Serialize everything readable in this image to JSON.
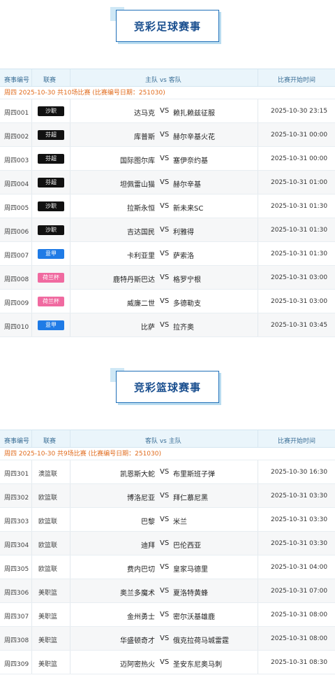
{
  "football": {
    "title": "竞彩足球赛事",
    "headers": {
      "id": "赛事编号",
      "league": "联赛",
      "teams": "主队 vs 客队",
      "time": "比赛开始时间"
    },
    "date_line": "周四 2025-10-30 共10场比赛 (比赛编号日期：251030)",
    "matches": [
      {
        "id": "周四001",
        "league": "沙职",
        "color": "#111111",
        "home": "达马克",
        "vs": "VS",
        "away": "赖扎赖兹征服",
        "time": "2025-10-30 23:15"
      },
      {
        "id": "周四002",
        "league": "芬超",
        "color": "#111111",
        "home": "库普斯",
        "vs": "VS",
        "away": "赫尔辛基火花",
        "time": "2025-10-31 00:00"
      },
      {
        "id": "周四003",
        "league": "芬超",
        "color": "#111111",
        "home": "国际图尔库",
        "vs": "VS",
        "away": "塞伊奈约基",
        "time": "2025-10-31 00:00"
      },
      {
        "id": "周四004",
        "league": "芬超",
        "color": "#111111",
        "home": "坦佩雷山猫",
        "vs": "VS",
        "away": "赫尔辛基",
        "time": "2025-10-31 01:00"
      },
      {
        "id": "周四005",
        "league": "沙职",
        "color": "#111111",
        "home": "拉斯永恒",
        "vs": "VS",
        "away": "新未来SC",
        "time": "2025-10-31 01:30"
      },
      {
        "id": "周四006",
        "league": "沙职",
        "color": "#111111",
        "home": "吉达国民",
        "vs": "VS",
        "away": "利雅得",
        "time": "2025-10-31 01:30"
      },
      {
        "id": "周四007",
        "league": "意甲",
        "color": "#1f7be6",
        "home": "卡利亚里",
        "vs": "VS",
        "away": "萨索洛",
        "time": "2025-10-31 01:30"
      },
      {
        "id": "周四008",
        "league": "荷兰杯",
        "color": "#f06aa0",
        "home": "鹿特丹斯巴达",
        "vs": "VS",
        "away": "格罗宁根",
        "time": "2025-10-31 03:00"
      },
      {
        "id": "周四009",
        "league": "荷兰杯",
        "color": "#f06aa0",
        "home": "威廉二世",
        "vs": "VS",
        "away": "多德勒支",
        "time": "2025-10-31 03:00"
      },
      {
        "id": "周四010",
        "league": "意甲",
        "color": "#1f7be6",
        "home": "比萨",
        "vs": "VS",
        "away": "拉齐奥",
        "time": "2025-10-31 03:45"
      }
    ]
  },
  "basketball": {
    "title": "竞彩篮球赛事",
    "headers": {
      "id": "赛事编号",
      "league": "联赛",
      "teams": "客队 vs 主队",
      "time": "比赛开始时间"
    },
    "date_line": "周四 2025-10-30 共9场比赛 (比赛编号日期：251030)",
    "matches": [
      {
        "id": "周四301",
        "league": "澳篮联",
        "away": "凯恩斯大蛇",
        "vs": "VS",
        "home": "布里斯班子弹",
        "time": "2025-10-30 16:30"
      },
      {
        "id": "周四302",
        "league": "欧篮联",
        "away": "博洛尼亚",
        "vs": "VS",
        "home": "拜仁慕尼黑",
        "time": "2025-10-31 03:30"
      },
      {
        "id": "周四303",
        "league": "欧篮联",
        "away": "巴黎",
        "vs": "VS",
        "home": "米兰",
        "time": "2025-10-31 03:30"
      },
      {
        "id": "周四304",
        "league": "欧篮联",
        "away": "迪拜",
        "vs": "VS",
        "home": "巴伦西亚",
        "time": "2025-10-31 03:30"
      },
      {
        "id": "周四305",
        "league": "欧篮联",
        "away": "费内巴切",
        "vs": "VS",
        "home": "皇家马德里",
        "time": "2025-10-31 04:00"
      },
      {
        "id": "周四306",
        "league": "美职篮",
        "away": "奥兰多魔术",
        "vs": "VS",
        "home": "夏洛特黄蜂",
        "time": "2025-10-31 07:00"
      },
      {
        "id": "周四307",
        "league": "美职篮",
        "away": "金州勇士",
        "vs": "VS",
        "home": "密尔沃基雄鹿",
        "time": "2025-10-31 08:00"
      },
      {
        "id": "周四308",
        "league": "美职篮",
        "away": "华盛顿奇才",
        "vs": "VS",
        "home": "俄克拉荷马城雷霆",
        "time": "2025-10-31 08:00"
      },
      {
        "id": "周四309",
        "league": "美职篮",
        "away": "迈阿密热火",
        "vs": "VS",
        "home": "圣安东尼奥马刺",
        "time": "2025-10-31 08:30"
      }
    ]
  }
}
